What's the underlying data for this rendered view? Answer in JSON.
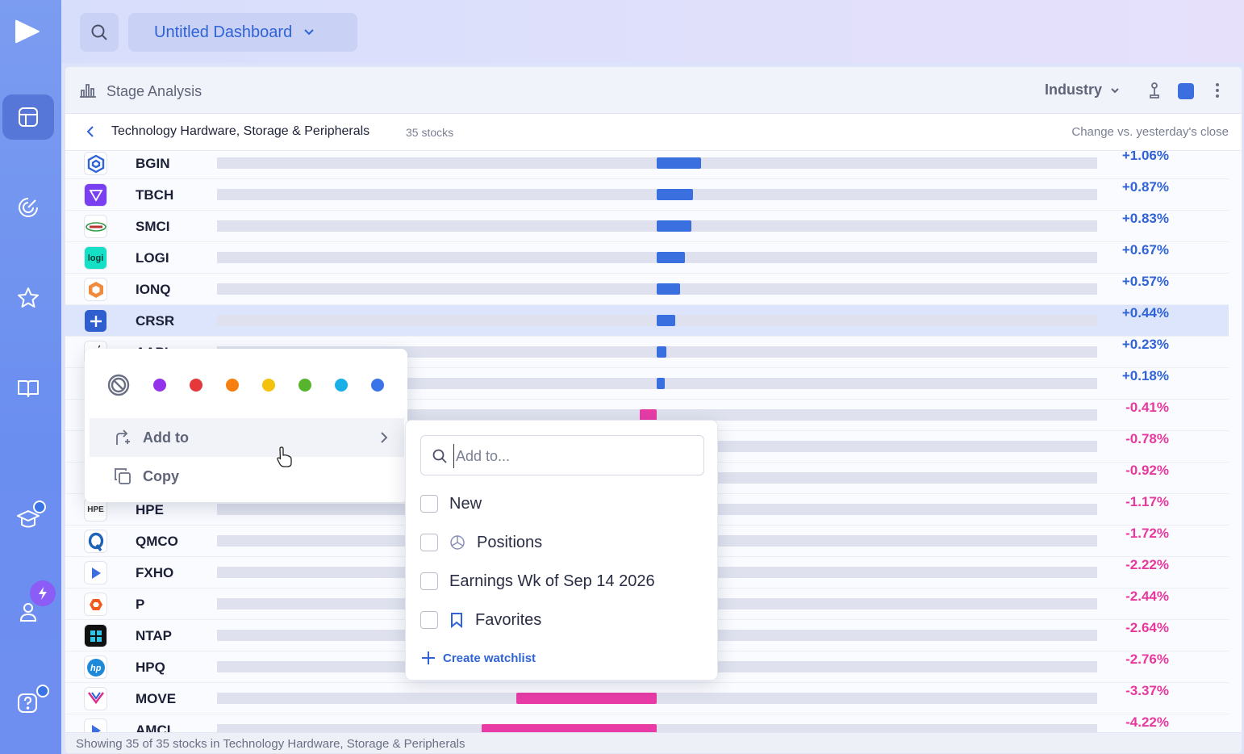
{
  "header": {
    "dashboard_title": "Untitled Dashboard"
  },
  "panel": {
    "title": "Stage Analysis",
    "grouping": "Industry",
    "accent_color": "#3b6fe0",
    "industry_name": "Technology Hardware, Storage & Peripherals",
    "stock_count": "35 stocks",
    "comparison": "Change vs. yesterday's close",
    "footer": "Showing 35 of 35 stocks in Technology Hardware, Storage & Peripherals"
  },
  "rows": [
    {
      "symbol": "BGIN",
      "change": "+1.06%",
      "value": 1.06,
      "logo": "bgin-logo"
    },
    {
      "symbol": "TBCH",
      "change": "+0.87%",
      "value": 0.87,
      "logo": "tbch-logo"
    },
    {
      "symbol": "SMCI",
      "change": "+0.83%",
      "value": 0.83,
      "logo": "smci-logo"
    },
    {
      "symbol": "LOGI",
      "change": "+0.67%",
      "value": 0.67,
      "logo": "logi-logo"
    },
    {
      "symbol": "IONQ",
      "change": "+0.57%",
      "value": 0.57,
      "logo": "ionq-logo"
    },
    {
      "symbol": "CRSR",
      "change": "+0.44%",
      "value": 0.44,
      "logo": "crsr-logo",
      "selected": true
    },
    {
      "symbol": "AAPL",
      "change": "+0.23%",
      "value": 0.23,
      "logo": "apple-logo"
    },
    {
      "symbol": "",
      "change": "+0.18%",
      "value": 0.18,
      "logo": ""
    },
    {
      "symbol": "",
      "change": "-0.41%",
      "value": -0.41,
      "logo": ""
    },
    {
      "symbol": "",
      "change": "-0.78%",
      "value": -0.78,
      "logo": ""
    },
    {
      "symbol": "",
      "change": "-0.92%",
      "value": -0.92,
      "logo": ""
    },
    {
      "symbol": "HPE",
      "change": "-1.17%",
      "value": -1.17,
      "logo": "hpe-logo"
    },
    {
      "symbol": "QMCO",
      "change": "-1.72%",
      "value": -1.72,
      "logo": "qmco-logo"
    },
    {
      "symbol": "FXHO",
      "change": "-2.22%",
      "value": -2.22,
      "logo": "fxho-logo"
    },
    {
      "symbol": "P",
      "change": "-2.44%",
      "value": -2.44,
      "logo": "p-logo"
    },
    {
      "symbol": "NTAP",
      "change": "-2.64%",
      "value": -2.64,
      "logo": "ntap-logo"
    },
    {
      "symbol": "HPQ",
      "change": "-2.76%",
      "value": -2.76,
      "logo": "hpq-logo"
    },
    {
      "symbol": "MOVE",
      "change": "-3.37%",
      "value": -3.37,
      "logo": "move-logo"
    },
    {
      "symbol": "AMCI",
      "change": "-4.22%",
      "value": -4.22,
      "logo": "amci-logo"
    }
  ],
  "context_menu": {
    "colors": [
      "#9333ea",
      "#e5383b",
      "#f77f10",
      "#f2c20c",
      "#56b52c",
      "#19b0e8",
      "#3b73e8"
    ],
    "add_to": "Add to",
    "copy": "Copy"
  },
  "submenu": {
    "placeholder": "Add to...",
    "watchlists": [
      {
        "label": "New",
        "icon": ""
      },
      {
        "label": "Positions",
        "icon": "pie-icon"
      },
      {
        "label": "Earnings Wk of Sep 14 2026",
        "icon": ""
      },
      {
        "label": "Favorites",
        "icon": "bookmark-icon"
      }
    ],
    "create": "Create watchlist"
  }
}
